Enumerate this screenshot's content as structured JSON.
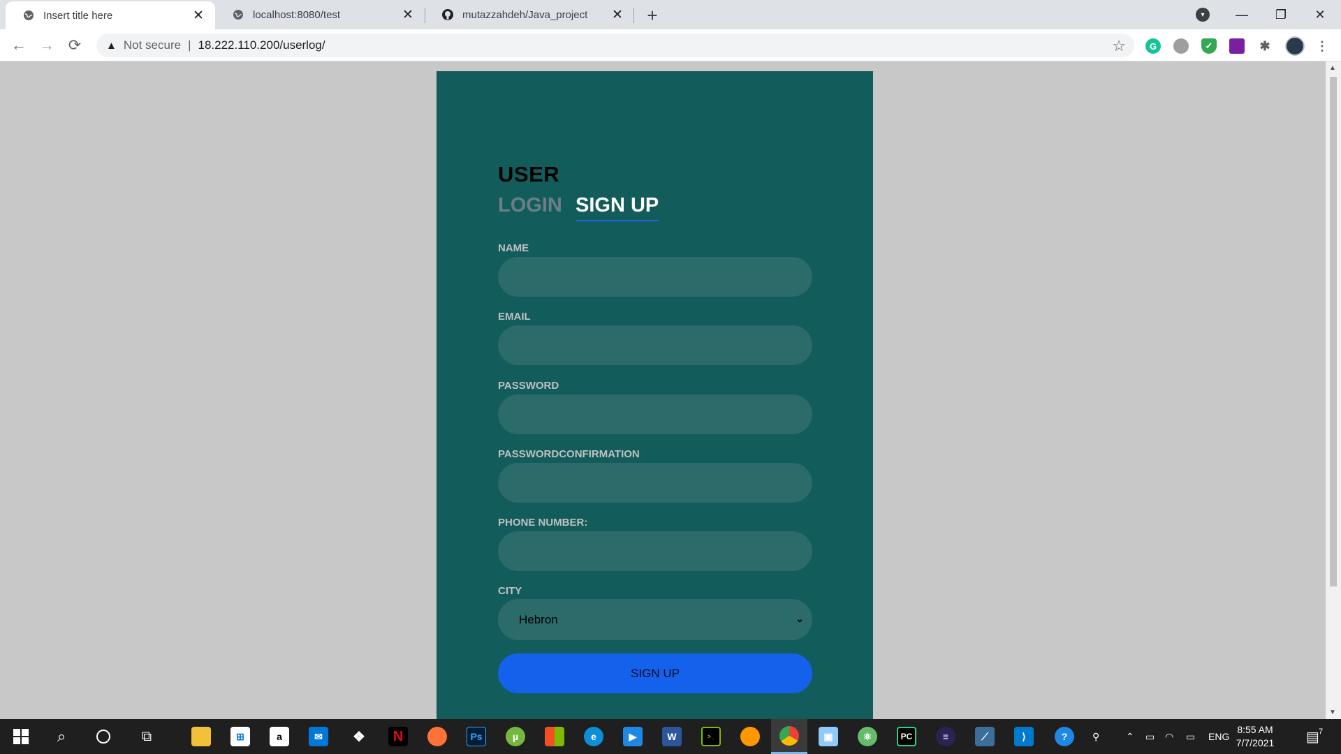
{
  "browser": {
    "tabs": [
      {
        "title": "Insert title here",
        "active": true,
        "favicon": "globe-icon"
      },
      {
        "title": "localhost:8080/test",
        "active": false,
        "favicon": "globe-icon"
      },
      {
        "title": "mutazzahdeh/Java_project",
        "active": false,
        "favicon": "github-icon"
      }
    ],
    "address": {
      "security_label": "Not secure",
      "url": "18.222.110.200/userlog/"
    }
  },
  "form": {
    "heading": "USER",
    "tab_login": "LOGIN",
    "tab_signup": "SIGN UP",
    "fields": [
      {
        "label": "NAME",
        "value": ""
      },
      {
        "label": "EMAIL",
        "value": ""
      },
      {
        "label": "PASSWORD",
        "value": ""
      },
      {
        "label": "PASSWORDCONFIRMATION",
        "value": ""
      },
      {
        "label": "PHONE NUMBER:",
        "value": ""
      }
    ],
    "city": {
      "label": "CITY",
      "selected": "Hebron"
    },
    "submit_label": "SIGN UP"
  },
  "taskbar": {
    "language": "ENG",
    "time": "8:55 AM",
    "date": "7/7/2021",
    "notification_count": "7"
  },
  "colors": {
    "card_bg": "#135c5c",
    "input_bg": "#2b6b69",
    "button_bg": "#1462eb",
    "page_bg": "#c8c8c8"
  }
}
